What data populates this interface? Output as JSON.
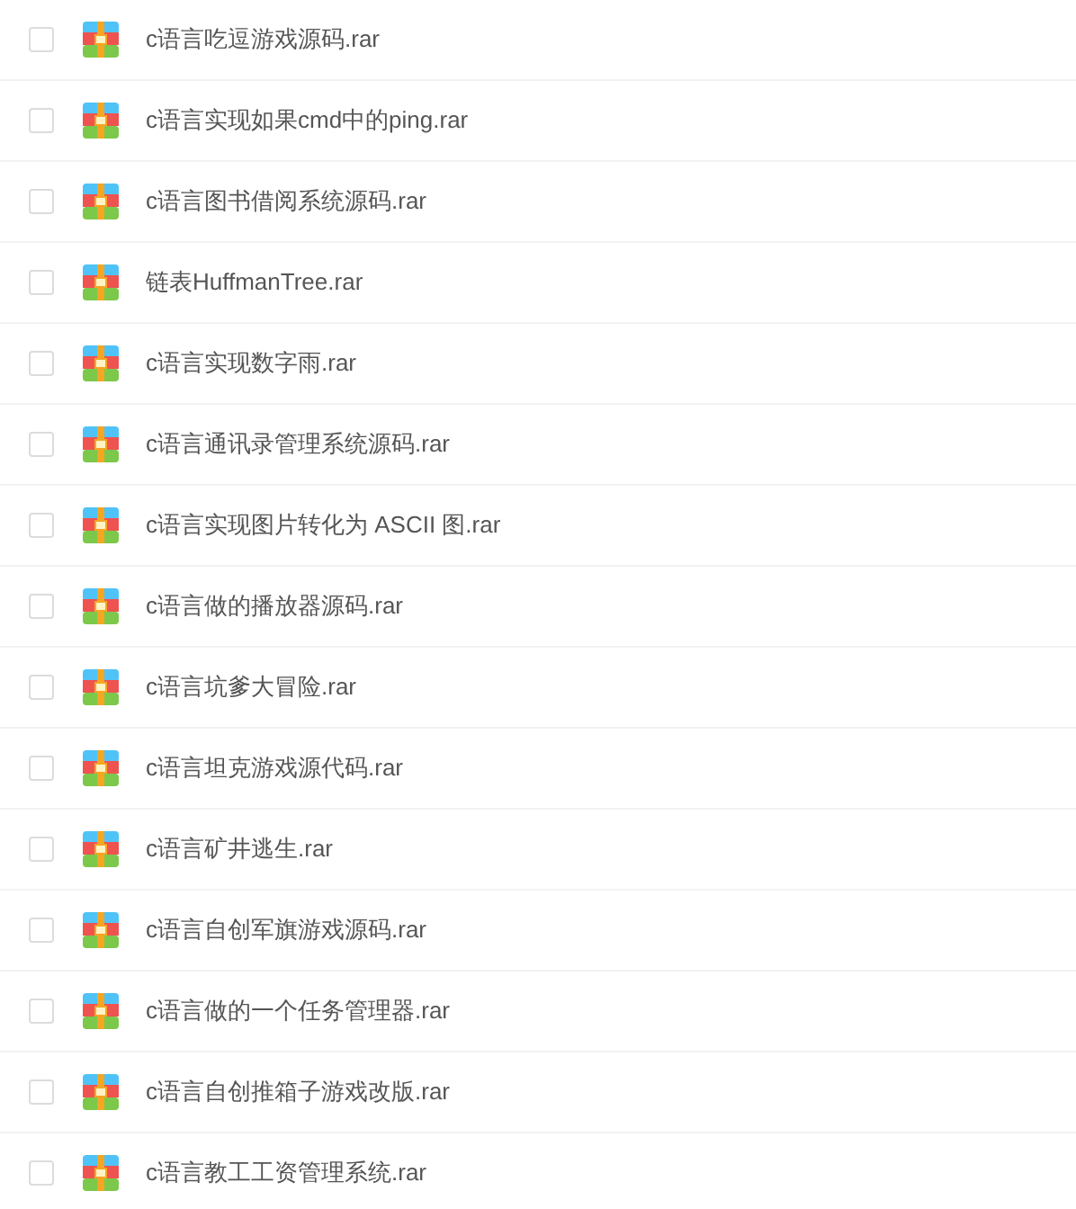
{
  "files": [
    {
      "name": "c语言吃逗游戏源码.rar",
      "checked": false
    },
    {
      "name": "c语言实现如果cmd中的ping.rar",
      "checked": false
    },
    {
      "name": "c语言图书借阅系统源码.rar",
      "checked": false
    },
    {
      "name": "链表HuffmanTree.rar",
      "checked": false
    },
    {
      "name": "c语言实现数字雨.rar",
      "checked": false
    },
    {
      "name": "c语言通讯录管理系统源码.rar",
      "checked": false
    },
    {
      "name": "c语言实现图片转化为 ASCII 图.rar",
      "checked": false
    },
    {
      "name": "c语言做的播放器源码.rar",
      "checked": false
    },
    {
      "name": "c语言坑爹大冒险.rar",
      "checked": false
    },
    {
      "name": "c语言坦克游戏源代码.rar",
      "checked": false
    },
    {
      "name": "c语言矿井逃生.rar",
      "checked": false
    },
    {
      "name": "c语言自创军旗游戏源码.rar",
      "checked": false
    },
    {
      "name": "c语言做的一个任务管理器.rar",
      "checked": false
    },
    {
      "name": "c语言自创推箱子游戏改版.rar",
      "checked": false
    },
    {
      "name": "c语言教工工资管理系统.rar",
      "checked": false
    }
  ]
}
